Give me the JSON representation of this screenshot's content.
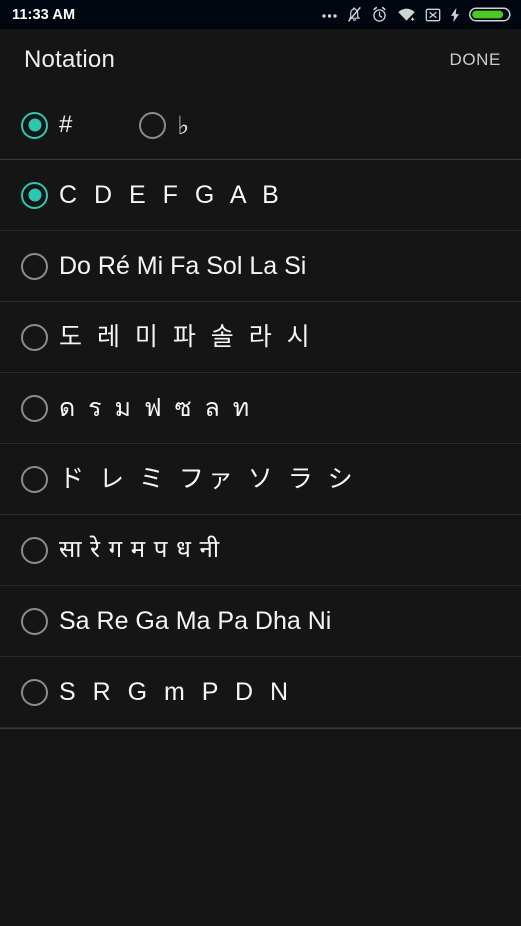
{
  "statusbar": {
    "time": "11:33 AM",
    "icons": [
      {
        "name": "more-icon",
        "label": "..."
      },
      {
        "name": "notifications-off-icon",
        "label": "bell-muted"
      },
      {
        "name": "alarm-icon",
        "label": "alarm"
      },
      {
        "name": "wifi-icon",
        "label": "wifi"
      },
      {
        "name": "no-sim-icon",
        "label": "x-box"
      },
      {
        "name": "charging-bolt-icon",
        "label": "bolt"
      },
      {
        "name": "battery-icon",
        "label": "battery"
      }
    ],
    "battery_color": "#4ac926"
  },
  "appbar": {
    "title": "Notation",
    "done_label": "DONE"
  },
  "accidentals": {
    "options": [
      {
        "label": "#",
        "selected": true,
        "name": "sharp"
      },
      {
        "label": "♭",
        "selected": false,
        "name": "flat"
      }
    ]
  },
  "notation_list": {
    "items": [
      {
        "label": "C D E F G A B",
        "selected": true,
        "style": "spaced"
      },
      {
        "label": "Do Ré Mi Fa Sol La Si",
        "selected": false,
        "style": "latin"
      },
      {
        "label": "도 레 미 파 솔 라 시",
        "selected": false,
        "style": "cjk"
      },
      {
        "label": "ด ร ม ฟ ซ ล ท",
        "selected": false,
        "style": "thai"
      },
      {
        "label": "ド レ ミ ファ ソ ラ シ",
        "selected": false,
        "style": "cjk"
      },
      {
        "label": "सा रे ग म प ध नी",
        "selected": false,
        "style": "deva"
      },
      {
        "label": "Sa Re Ga Ma Pa Dha Ni",
        "selected": false,
        "style": "latin"
      },
      {
        "label": "S R G m P D N",
        "selected": false,
        "style": "spaced"
      }
    ]
  },
  "colors": {
    "accent": "#2ec6b3",
    "background": "#151515",
    "statusbar_bg": "#00060f",
    "text": "#f5f5f5",
    "radio_off": "#8c8c8c",
    "divider": "#2b2b2b"
  }
}
